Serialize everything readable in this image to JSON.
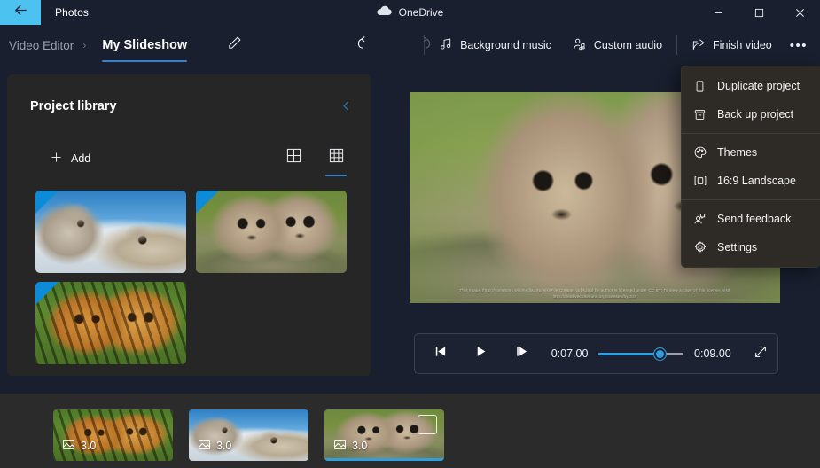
{
  "titlebar": {
    "back_icon": "back-arrow-icon",
    "app_name": "Photos",
    "onedrive_label": "OneDrive",
    "onedrive_icon": "cloud-icon",
    "minimize_icon": "minimize-icon",
    "maximize_icon": "maximize-icon",
    "close_icon": "close-icon"
  },
  "commandbar": {
    "breadcrumb_parent": "Video Editor",
    "breadcrumb_separator": "›",
    "project_title": "My Slideshow",
    "rename_icon": "pencil-icon",
    "undo_icon": "undo-icon",
    "redo_icon": "redo-icon",
    "background_music": "Background music",
    "background_music_icon": "music-note-icon",
    "custom_audio": "Custom audio",
    "custom_audio_icon": "person-audio-icon",
    "finish_video": "Finish video",
    "finish_video_icon": "share-export-icon",
    "overflow_label": "•••",
    "overflow_icon": "more-options-icon"
  },
  "menu": {
    "groups": [
      [
        {
          "label": "Duplicate project",
          "icon": "duplicate-icon"
        },
        {
          "label": "Back up project",
          "icon": "archive-box-icon"
        }
      ],
      [
        {
          "label": "Themes",
          "icon": "palette-icon"
        },
        {
          "label": "16:9 Landscape",
          "icon": "aspect-ratio-icon"
        }
      ],
      [
        {
          "label": "Send feedback",
          "icon": "feedback-icon"
        },
        {
          "label": "Settings",
          "icon": "gear-icon"
        }
      ]
    ]
  },
  "library": {
    "title": "Project library",
    "collapse_icon": "chevron-left-icon",
    "add_label": "Add",
    "add_icon": "plus-icon",
    "view_large_icon": "grid-large-icon",
    "view_small_icon": "grid-small-icon",
    "active_view": "grid-small",
    "items": [
      {
        "name": "wolves",
        "scene": "sc-wolves",
        "selected": true
      },
      {
        "name": "cougar-cubs",
        "scene": "sc-cougars",
        "selected": true
      },
      {
        "name": "tiger-cubs",
        "scene": "sc-tigers",
        "selected": true
      }
    ]
  },
  "preview": {
    "scene": "sc-preview",
    "caption": "This image (http://commons.wikimedia.org/wiki/File:Cougar_cubs.jpg) by author is licensed under CC BY. To view a copy of this license, visit http://creativecommons.org/licenses/by/3.0/"
  },
  "player": {
    "prev_frame_icon": "previous-frame-icon",
    "play_icon": "play-icon",
    "next_frame_icon": "next-frame-icon",
    "current_time": "0:07.00",
    "total_time": "0:09.00",
    "progress_percent": 72,
    "fullscreen_icon": "fullscreen-icon"
  },
  "timeline": {
    "clips": [
      {
        "duration": "3.0",
        "icon": "image-icon",
        "scene": "sc-tigers",
        "selected": false
      },
      {
        "duration": "3.0",
        "icon": "image-icon",
        "scene": "sc-wolves",
        "selected": false
      },
      {
        "duration": "3.0",
        "icon": "image-icon",
        "scene": "sc-cougars",
        "selected": true
      }
    ]
  },
  "colors": {
    "accent": "#2f9fe0",
    "back_button_hover": "#4cc2f1",
    "window_bg": "#191f2e",
    "panel_bg": "#262626",
    "timeline_bg": "#2b2b2b",
    "menu_bg": "#2e2b26",
    "tab_underline": "#3b82c4",
    "corner_badge": "#0b8bd8"
  }
}
